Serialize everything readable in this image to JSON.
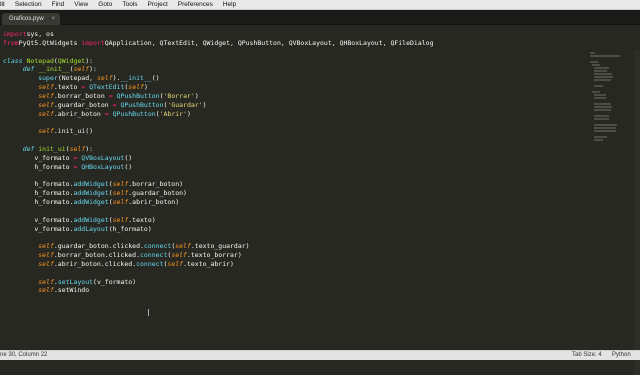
{
  "menubar": {
    "items": [
      "dit",
      "Selection",
      "Find",
      "View",
      "Goto",
      "Tools",
      "Project",
      "Preferences",
      "Help"
    ]
  },
  "tabbar": {
    "active_tab": "Graficos.pyw",
    "close_glyph": "×"
  },
  "status": {
    "position": "ne 30, Column 22",
    "tab_size": "Tab Size: 4",
    "syntax": "Python"
  },
  "colors": {
    "background": "#272822",
    "keyword": "#f92672",
    "function": "#a6e22e",
    "self": "#fd971f",
    "builtin": "#66d9ef",
    "string": "#e6db74"
  },
  "code": [
    [
      [
        "kw",
        "import"
      ],
      [
        "",
        "sys, os"
      ]
    ],
    [
      [
        "kw",
        "from"
      ],
      [
        "",
        "PyQt5.QtWidgets "
      ],
      [
        "kw",
        "import"
      ],
      [
        "",
        "QApplication, QTextEdit, QWidget, QPushButton, QVBoxLayout, QHBoxLayout, QFileDialog"
      ]
    ],
    [],
    [
      [
        "def",
        "class"
      ],
      [
        "",
        ""
      ],
      [
        "fn",
        "Notepad"
      ],
      [
        "",
        "("
      ],
      [
        "inh",
        "QWidget"
      ],
      [
        "",
        "):"
      ]
    ],
    [
      [
        "",
        ""
      ],
      [
        "def",
        "def"
      ],
      [
        "",
        ""
      ],
      [
        "fn",
        "__init__"
      ],
      [
        "",
        "("
      ],
      [
        "self",
        "self"
      ],
      [
        "",
        "):"
      ]
    ],
    [
      [
        "",
        ""
      ],
      [
        "bi",
        "super"
      ],
      [
        "",
        "(Notepad, "
      ],
      [
        "self",
        "self"
      ],
      [
        "",
        ")."
      ],
      [
        "bi",
        "__init__"
      ],
      [
        "",
        "()"
      ]
    ],
    [
      [
        "",
        ""
      ],
      [
        "self",
        "self"
      ],
      [
        "",
        ".texto "
      ],
      [
        "kw",
        "="
      ],
      [
        "",
        ""
      ],
      [
        "bi",
        "QTextEdit"
      ],
      [
        "",
        "("
      ],
      [
        "self",
        "self"
      ],
      [
        "",
        ")"
      ]
    ],
    [
      [
        "",
        ""
      ],
      [
        "self",
        "self"
      ],
      [
        "",
        ".borrar_boton "
      ],
      [
        "kw",
        "="
      ],
      [
        "",
        ""
      ],
      [
        "bi",
        "QPushButton"
      ],
      [
        "",
        "("
      ],
      [
        "str",
        "'Borrar'"
      ],
      [
        "",
        ")"
      ]
    ],
    [
      [
        "",
        ""
      ],
      [
        "self",
        "self"
      ],
      [
        "",
        ".guardar_boton "
      ],
      [
        "kw",
        "="
      ],
      [
        "",
        ""
      ],
      [
        "bi",
        "QPushButton"
      ],
      [
        "",
        "("
      ],
      [
        "str",
        "'Guardar'"
      ],
      [
        "",
        ")"
      ]
    ],
    [
      [
        "",
        ""
      ],
      [
        "self",
        "self"
      ],
      [
        "",
        ".abrir_boton "
      ],
      [
        "kw",
        "="
      ],
      [
        "",
        ""
      ],
      [
        "bi",
        "QPushButton"
      ],
      [
        "",
        "("
      ],
      [
        "str",
        "'Abrir'"
      ],
      [
        "",
        ")"
      ]
    ],
    [],
    [
      [
        "",
        ""
      ],
      [
        "self",
        "self"
      ],
      [
        "",
        ".init_ui()"
      ]
    ],
    [],
    [
      [
        "",
        ""
      ],
      [
        "def",
        "def"
      ],
      [
        "",
        ""
      ],
      [
        "fn",
        "init_ui"
      ],
      [
        "",
        "("
      ],
      [
        "self",
        "self"
      ],
      [
        "",
        "):"
      ]
    ],
    [
      [
        "",
        "v_formato "
      ],
      [
        "kw",
        "="
      ],
      [
        "",
        ""
      ],
      [
        "bi",
        "QVBoxLayout"
      ],
      [
        "",
        "()"
      ]
    ],
    [
      [
        "",
        "h_formato "
      ],
      [
        "kw",
        "="
      ],
      [
        "",
        ""
      ],
      [
        "bi",
        "QHBoxLayout"
      ],
      [
        "",
        "()"
      ]
    ],
    [],
    [
      [
        "",
        "h_formato."
      ],
      [
        "bi",
        "addWidget"
      ],
      [
        "",
        "("
      ],
      [
        "self",
        "self"
      ],
      [
        "",
        ".borrar_boton)"
      ]
    ],
    [
      [
        "",
        "h_formato."
      ],
      [
        "bi",
        "addWidget"
      ],
      [
        "",
        "("
      ],
      [
        "self",
        "self"
      ],
      [
        "",
        ".guardar_boton)"
      ]
    ],
    [
      [
        "",
        "h_formato."
      ],
      [
        "bi",
        "addWidget"
      ],
      [
        "",
        "("
      ],
      [
        "self",
        "self"
      ],
      [
        "",
        ".abrir_boton)"
      ]
    ],
    [],
    [
      [
        "",
        "v_formato."
      ],
      [
        "bi",
        "addWidget"
      ],
      [
        "",
        "("
      ],
      [
        "self",
        "self"
      ],
      [
        "",
        ".texto)"
      ]
    ],
    [
      [
        "",
        "v_formato."
      ],
      [
        "bi",
        "addLayout"
      ],
      [
        "",
        "(h_formato)"
      ]
    ],
    [],
    [
      [
        "",
        ""
      ],
      [
        "self",
        "self"
      ],
      [
        "",
        ".guardar_boton.clicked."
      ],
      [
        "bi",
        "connect"
      ],
      [
        "",
        "("
      ],
      [
        "self",
        "self"
      ],
      [
        "",
        ".texto_guardar)"
      ]
    ],
    [
      [
        "",
        ""
      ],
      [
        "self",
        "self"
      ],
      [
        "",
        ".borrar_boton.clicked."
      ],
      [
        "bi",
        "connect"
      ],
      [
        "",
        "("
      ],
      [
        "self",
        "self"
      ],
      [
        "",
        ".texto_borrar)"
      ]
    ],
    [
      [
        "",
        ""
      ],
      [
        "self",
        "self"
      ],
      [
        "",
        ".abrir_boton.clicked."
      ],
      [
        "bi",
        "connect"
      ],
      [
        "",
        "("
      ],
      [
        "self",
        "self"
      ],
      [
        "",
        ".texto_abrir)"
      ]
    ],
    [],
    [
      [
        "",
        ""
      ],
      [
        "self",
        "self"
      ],
      [
        "",
        "."
      ],
      [
        "bi",
        "setLayout"
      ],
      [
        "",
        "(v_formato)"
      ]
    ],
    [
      [
        "",
        ""
      ],
      [
        "self",
        "self"
      ],
      [
        "",
        ".setWindo"
      ]
    ]
  ]
}
